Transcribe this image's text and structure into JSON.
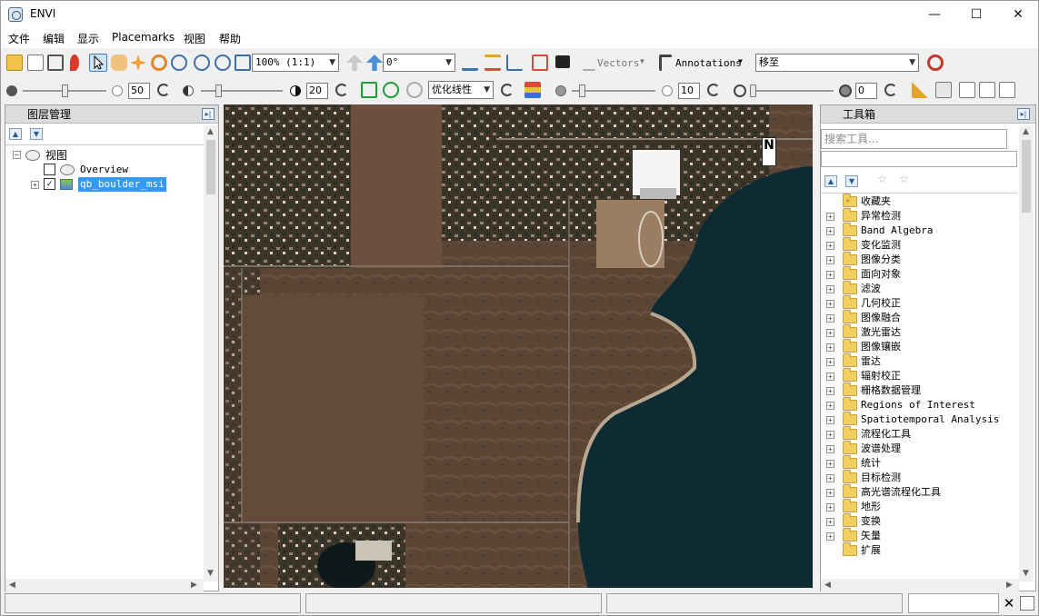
{
  "window": {
    "title": "ENVI",
    "minimize_label": "—",
    "maximize_label": "☐",
    "close_label": "✕"
  },
  "menu": [
    "文件",
    "编辑",
    "显示",
    "Placemarks",
    "视图",
    "帮助"
  ],
  "toolbar1": {
    "zoom_value": "100% (1:1)",
    "rotation_value": "0°",
    "vectors_label": "Vectors",
    "annotations_label": "Annotations",
    "goto_value": "移至"
  },
  "toolbar2": {
    "brightness_value": "50",
    "contrast_value": "20",
    "stretch_value": "优化线性",
    "sharpen_value": "10",
    "transparency_value": "0"
  },
  "layer_panel": {
    "title": "图层管理",
    "root_label": "视图",
    "items": [
      {
        "label": "Overview",
        "checked": false
      },
      {
        "label": "qb_boulder_msi",
        "checked": true
      }
    ]
  },
  "toolbox": {
    "title": "工具箱",
    "search_placeholder": "搜索工具...",
    "items": [
      "收藏夹",
      "异常检测",
      "Band Algebra",
      "变化监测",
      "图像分类",
      "面向对象",
      "滤波",
      "几何校正",
      "图像融合",
      "激光雷达",
      "图像镶嵌",
      "雷达",
      "辐射校正",
      "栅格数据管理",
      "Regions of Interest",
      "Spatiotemporal Analysis",
      "流程化工具",
      "波谱处理",
      "统计",
      "目标检测",
      "高光谱流程化工具",
      "地形",
      "变换",
      "矢量",
      "扩展"
    ]
  },
  "map": {
    "north_label": "N"
  },
  "colors": {
    "selection": "#3399ff",
    "water": "#0e2a33",
    "land": "#5a4534"
  }
}
